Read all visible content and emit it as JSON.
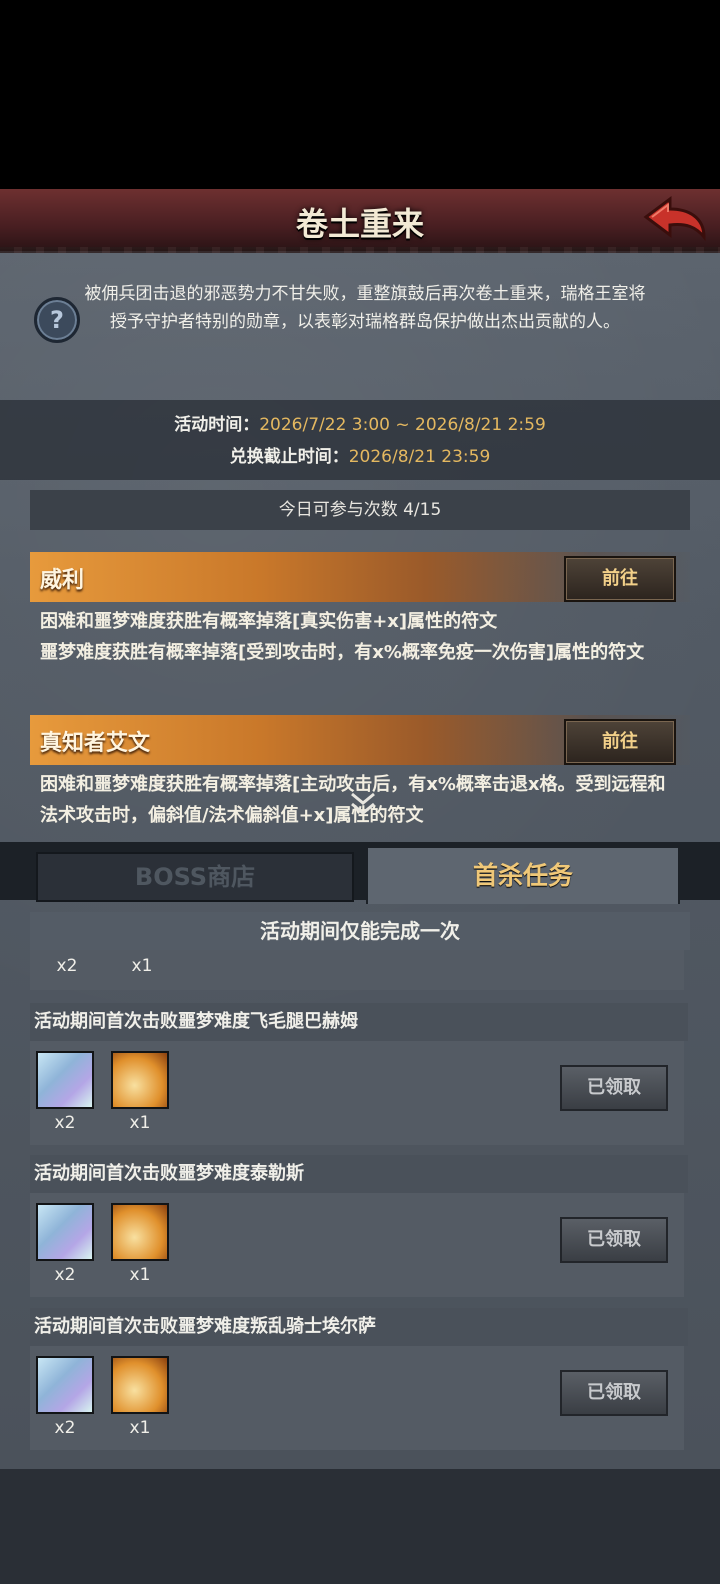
{
  "header": {
    "title": "卷土重来"
  },
  "intro": "被佣兵团击退的邪恶势力不甘失败，重整旗鼓后再次卷土重来，瑞格王室将授予守护者特别的勋章，以表彰对瑞格群岛保护做出杰出贡献的人。",
  "event": {
    "time_label": "活动时间：",
    "time_value": "2026/7/22 3:00 ~ 2026/8/21 2:59",
    "exchange_label": "兑换截止时间：",
    "exchange_value": "2026/8/21 23:59",
    "attempts": "今日可参与次数  4/15"
  },
  "bosses": [
    {
      "name": "威利",
      "go_label": "前往",
      "desc": "困难和噩梦难度获胜有概率掉落[真实伤害+x]属性的符文\n噩梦难度获胜有概率掉落[受到攻击时，有x%概率免疫一次伤害]属性的符文"
    },
    {
      "name": "真知者艾文",
      "go_label": "前往",
      "desc": "困难和噩梦难度获胜有概率掉落[主动攻击后，有x%概率击退x格。受到远程和法术攻击时，偏斜值/法术偏斜值+x]属性的符文"
    }
  ],
  "tabs": {
    "boss_shop": "BOSS商店",
    "first_kill": "首杀任务"
  },
  "section_note": "活动期间仅能完成一次",
  "partial_rewards": [
    "x2",
    "x1"
  ],
  "tasks": [
    {
      "title": "活动期间首次击败噩梦难度飞毛腿巴赫姆",
      "rewards": [
        {
          "icon": "crystal-icon",
          "count": "x2"
        },
        {
          "icon": "feather-icon",
          "count": "x1"
        }
      ],
      "status": "已领取"
    },
    {
      "title": "活动期间首次击败噩梦难度泰勒斯",
      "rewards": [
        {
          "icon": "crystal-icon",
          "count": "x2"
        },
        {
          "icon": "feather-icon",
          "count": "x1"
        }
      ],
      "status": "已领取"
    },
    {
      "title": "活动期间首次击败噩梦难度叛乱骑士埃尔萨",
      "rewards": [
        {
          "icon": "crystal-icon",
          "count": "x2"
        },
        {
          "icon": "feather-icon",
          "count": "x1"
        }
      ],
      "status": "已领取"
    }
  ]
}
